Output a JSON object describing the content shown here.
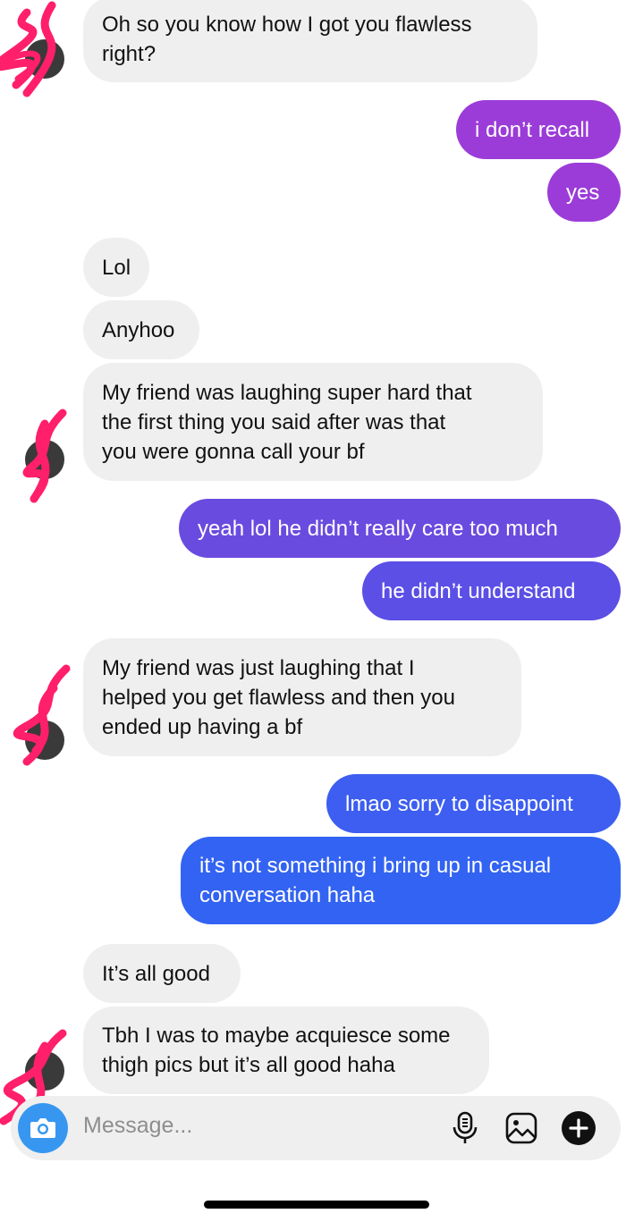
{
  "conversation": {
    "messages": [
      {
        "sender": "them",
        "text_lines": [
          "Oh so you know how I got you flawless",
          "right?"
        ]
      },
      {
        "sender": "me",
        "text_lines": [
          "i don’t recall"
        ],
        "color": "#9b3cd8"
      },
      {
        "sender": "me",
        "text_lines": [
          "yes"
        ],
        "color": "#9b3cd8"
      },
      {
        "sender": "them",
        "text_lines": [
          "Lol"
        ]
      },
      {
        "sender": "them",
        "text_lines": [
          "Anyhoo"
        ]
      },
      {
        "sender": "them",
        "text_lines": [
          "My friend was laughing super hard that",
          "the first thing you said after was that",
          "you were gonna call your bf"
        ]
      },
      {
        "sender": "me",
        "text_lines": [
          "yeah lol he didn’t really care too much"
        ],
        "color": "#6a4be0"
      },
      {
        "sender": "me",
        "text_lines": [
          "he didn’t understand"
        ],
        "color": "#5b4fe6"
      },
      {
        "sender": "them",
        "text_lines": [
          "My friend was just laughing that I",
          "helped you get flawless and then you",
          "ended up having a bf"
        ]
      },
      {
        "sender": "me",
        "text_lines": [
          "lmao sorry to disappoint"
        ],
        "color": "#3d5ef0"
      },
      {
        "sender": "me",
        "text_lines": [
          "it’s not something i bring up in casual",
          "conversation haha"
        ],
        "color": "#3363f2"
      },
      {
        "sender": "them",
        "text_lines": [
          "It’s all good"
        ]
      },
      {
        "sender": "them",
        "text_lines": [
          "Tbh I was to maybe acquiesce some",
          "thigh pics but it’s all good haha"
        ]
      }
    ]
  },
  "composer": {
    "placeholder": "Message...",
    "icons": [
      "camera-icon",
      "microphone-icon",
      "gallery-icon",
      "plus-icon"
    ],
    "camera_color": "#3797f0"
  },
  "colors": {
    "incoming_bubble": "#efefef",
    "redaction_scribble": "#ff1f6a"
  }
}
